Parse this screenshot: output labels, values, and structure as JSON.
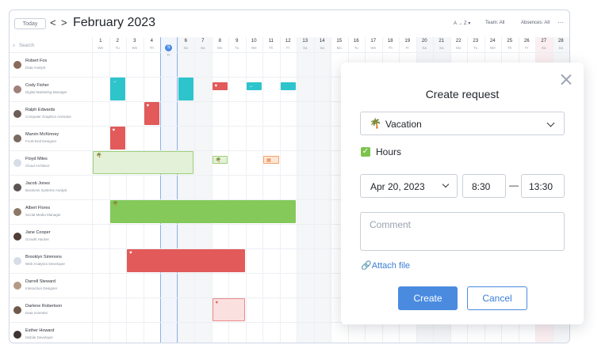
{
  "toolbar": {
    "today": "Today",
    "prev": "<",
    "next": ">",
    "month": "February 2023",
    "sort": "A → Z ▾",
    "team": "Team: All",
    "absences": "Absences: All",
    "more": "···"
  },
  "search_placeholder": "Search",
  "days": [
    {
      "n": "1",
      "w": "We"
    },
    {
      "n": "2",
      "w": "Tu"
    },
    {
      "n": "3",
      "w": "We"
    },
    {
      "n": "4",
      "w": "Th"
    },
    {
      "n": "5",
      "w": "Fr",
      "today": true
    },
    {
      "n": "6",
      "w": "Sa"
    },
    {
      "n": "7",
      "w": "Sa"
    },
    {
      "n": "8",
      "w": "Mo"
    },
    {
      "n": "9",
      "w": "Tu"
    },
    {
      "n": "10",
      "w": "We"
    },
    {
      "n": "11",
      "w": "Th"
    },
    {
      "n": "12",
      "w": "Fr"
    },
    {
      "n": "13",
      "w": "Sa"
    },
    {
      "n": "14",
      "w": "Sa"
    },
    {
      "n": "15",
      "w": "Mo"
    },
    {
      "n": "16",
      "w": "Tu"
    },
    {
      "n": "17",
      "w": "We"
    },
    {
      "n": "18",
      "w": "Th"
    },
    {
      "n": "19",
      "w": "Fr"
    },
    {
      "n": "20",
      "w": "Sa"
    },
    {
      "n": "21",
      "w": "Sa"
    },
    {
      "n": "22",
      "w": "Mo"
    },
    {
      "n": "23",
      "w": "Tu"
    },
    {
      "n": "24",
      "w": "We"
    },
    {
      "n": "25",
      "w": "Th"
    },
    {
      "n": "26",
      "w": "Fr"
    },
    {
      "n": "27",
      "w": "Sa"
    },
    {
      "n": "28",
      "w": "Sa"
    }
  ],
  "people": [
    {
      "name": "Robert Fox",
      "role": "Data Analyst",
      "avatar": "#8a6a5a"
    },
    {
      "name": "Cody Fisher",
      "role": "Digital Marketing Manager",
      "avatar": "#a0807a"
    },
    {
      "name": "Ralph Edwards",
      "role": "Computer Graphics Animator",
      "avatar": "#6b5e58"
    },
    {
      "name": "Marvin McKinney",
      "role": "Front-End Designer",
      "avatar": "#7a6a5f"
    },
    {
      "name": "Floyd Miles",
      "role": "Cloud Architect",
      "avatar": "#d6dde8"
    },
    {
      "name": "Jacob Jones",
      "role": "Business Systems Analyst",
      "avatar": "#5a5452"
    },
    {
      "name": "Albert Flores",
      "role": "Social Media Manager",
      "avatar": "#8d7868"
    },
    {
      "name": "Jane Cooper",
      "role": "Growth Hacker",
      "avatar": "#4f3d36"
    },
    {
      "name": "Brooklyn Simmons",
      "role": "Web Analytics Developer",
      "avatar": "#d6dde8"
    },
    {
      "name": "Darrell Steward",
      "role": "Interaction Designer",
      "avatar": "#b49a84"
    },
    {
      "name": "Darlene Robertson",
      "role": "Data Scientist",
      "avatar": "#6e5a4c"
    },
    {
      "name": "Esther Howard",
      "role": "Mobile Developer",
      "avatar": "#3e3432"
    }
  ],
  "absences": [
    {
      "row": 1,
      "start": 1,
      "span": 1,
      "type": "business-trip",
      "icon": "→"
    },
    {
      "row": 1,
      "start": 5,
      "span": 1,
      "type": "business-trip",
      "icon": ""
    },
    {
      "row": 1,
      "start": 7,
      "span": 1,
      "type": "sick-half",
      "icon": "♥"
    },
    {
      "row": 1,
      "start": 9,
      "span": 1,
      "type": "business-trip-half",
      "icon": "→"
    },
    {
      "row": 1,
      "start": 11,
      "span": 1,
      "type": "business-trip-half",
      "icon": ""
    },
    {
      "row": 2,
      "start": 3,
      "span": 1,
      "type": "sick",
      "icon": "♥"
    },
    {
      "row": 3,
      "start": 1,
      "span": 1,
      "type": "sick",
      "icon": "♥"
    },
    {
      "row": 4,
      "start": 0,
      "span": 6,
      "type": "vacation-pending",
      "icon": "🌴"
    },
    {
      "row": 4,
      "start": 7,
      "span": 1,
      "type": "vacation-pending-half",
      "icon": "🌴"
    },
    {
      "row": 4,
      "start": 10,
      "span": 1,
      "type": "dayoff-pending-half",
      "icon": "▦"
    },
    {
      "row": 6,
      "start": 1,
      "span": 11,
      "type": "vacation",
      "icon": "🌴"
    },
    {
      "row": 8,
      "start": 2,
      "span": 7,
      "type": "sick",
      "icon": "♥"
    },
    {
      "row": 10,
      "start": 7,
      "span": 2,
      "type": "sick-pending",
      "icon": "♥"
    }
  ],
  "type_colors": {
    "business-trip": "#2ec4cc",
    "business-trip-half": "#2ec4cc",
    "sick": "#e25a5a",
    "sick-half": "#e25a5a",
    "vacation": "#84c95a",
    "vacation-pending": "#e2f1d8",
    "vacation-pending-half": "#e2f1d8",
    "dayoff-pending-half": "#fde6d4",
    "sick-pending": "#fbe0e0"
  },
  "modal": {
    "title": "Create request",
    "type_value": "Vacation",
    "type_icon": "🌴",
    "hours_label": "Hours",
    "hours_checked": true,
    "date_value": "Apr 20, 2023",
    "time_from": "8:30",
    "time_to": "13:30",
    "dash": "—",
    "comment_placeholder": "Comment",
    "attach_label": "Attach file",
    "create_label": "Create",
    "cancel_label": "Cancel"
  },
  "colors": {
    "accent": "#4a8be0",
    "vacation": "#84c95a",
    "sick": "#e25a5a",
    "trip": "#2ec4cc"
  }
}
